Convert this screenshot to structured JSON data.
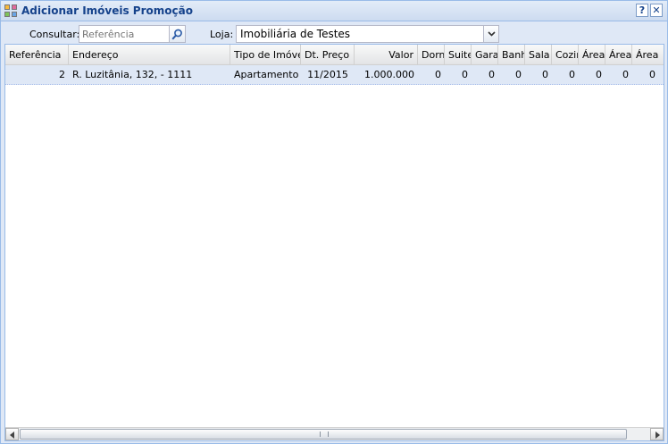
{
  "window": {
    "title": "Adicionar Imóveis Promoção",
    "help_label": "?",
    "close_label": "✕"
  },
  "filters": {
    "consultar_label": "Consultar:",
    "search_placeholder": "Referência",
    "search_value": "",
    "loja_label": "Loja:",
    "loja_value": "Imobiliária de Testes"
  },
  "columns": [
    "Referência",
    "Endereço",
    "Tipo de Imóvel",
    "Dt. Preço",
    "Valor",
    "Dorm",
    "Suite",
    "Gara",
    "Banh",
    "Sala",
    "Cozir",
    "Área",
    "Área",
    "Área"
  ],
  "rows": [
    {
      "referencia": "2",
      "endereco": "R. Luzitânia, 132, - 1111",
      "tipo": "Apartamento",
      "dt_preco": "11/2015",
      "valor": "1.000.000",
      "dorm": "0",
      "suite": "0",
      "gara": "0",
      "banh": "0",
      "sala": "0",
      "cozinha": "0",
      "area1": "0",
      "area2": "0",
      "area3": "0"
    }
  ],
  "colors": {
    "title_text": "#15428b",
    "row_selected": "#dfe8f6",
    "border": "#99bbe8"
  }
}
